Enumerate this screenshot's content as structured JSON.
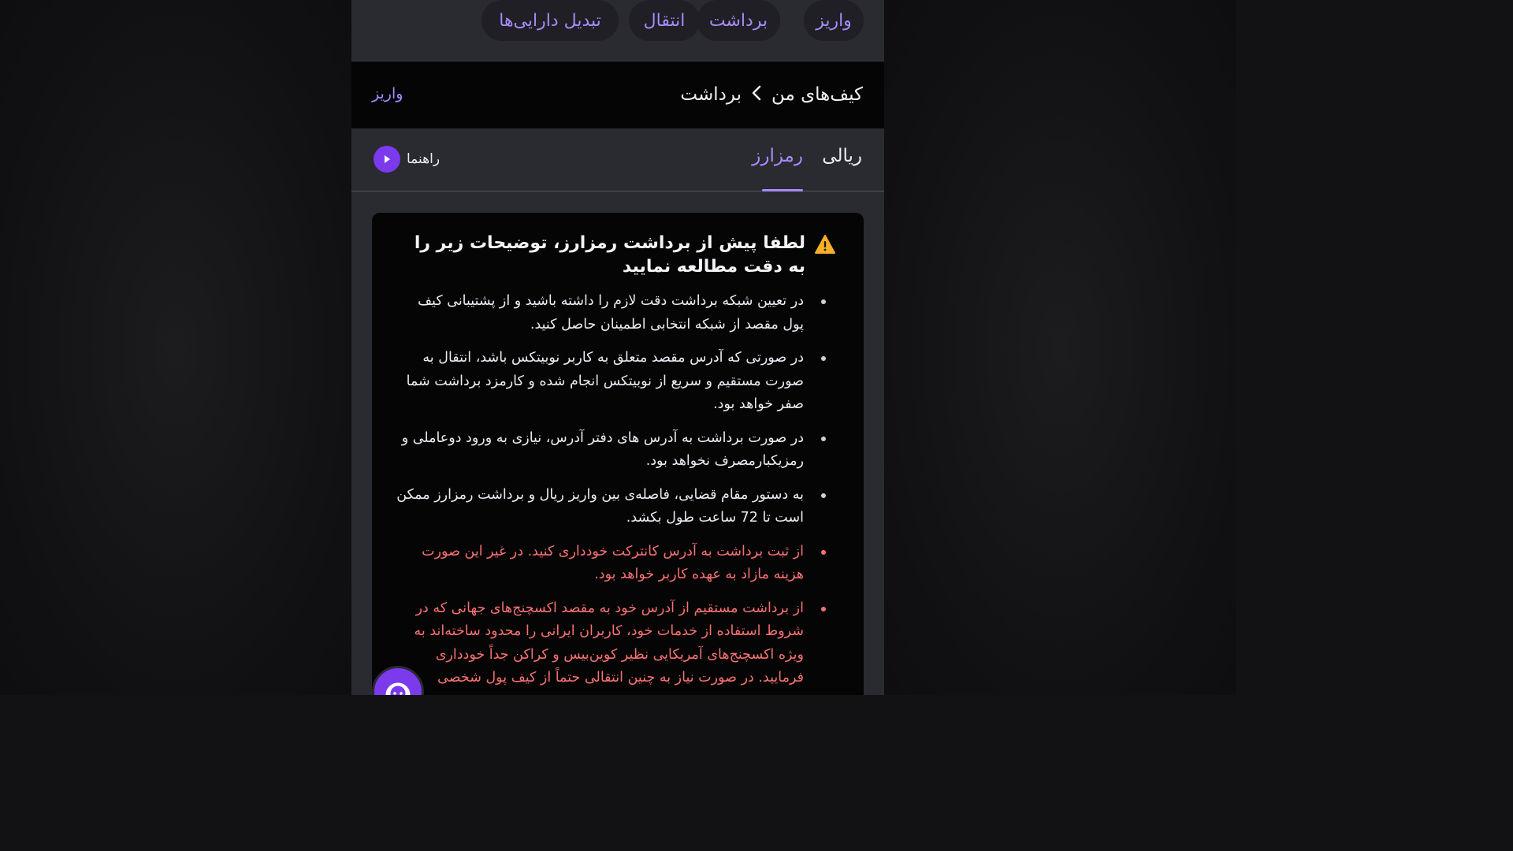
{
  "top_actions": [
    "واریز",
    "برداشت",
    "انتقال",
    "تبدیل دارایی‌ها"
  ],
  "header": {
    "breadcrumb_root": "کیف‌های من",
    "breadcrumb_current": "برداشت",
    "side_link": "واریز"
  },
  "tabs": [
    "ریالی",
    "رمزارز"
  ],
  "active_tab": "رمزارز",
  "guide_label": "راهنما",
  "notice": {
    "title": "لطفا پیش از برداشت رمزارز، توضیحات زیر را به دقت مطالعه نمایید",
    "items": [
      "در تعیین شبکه برداشت دقت لازم را داشته باشید و از پشتیبانی کیف پول مقصد از شبکه انتخابی اطمینان حاصل کنید.",
      "در صورتی که آدرس مقصد متعلق به کاربر نوبیتکس باشد، انتقال به صورت مستقیم و سریع از نوبیتکس انجام شده و کارمزد برداشت شما صفر خواهد بود.",
      "در صورت برداشت به آدرس های دفتر آدرس، نیازی به ورود دوعاملی و رمزیکبارمصرف نخواهد بود.",
      "به دستور مقام قضایی، فاصله‌ی بین واریز ریال و برداشت رمزارز ممکن است تا 72 ساعت طول بکشد.",
      "از ثبت برداشت به آدرس کانترکت خودداری کنید. در غیر این صورت هزینه مازاد به عهده کاربر خواهد بود.",
      "از برداشت مستقیم از آدرس خود به مقصد اکسچنج‌های جهانی که در شروط استفاده از خدمات خود، کاربران ایرانی را محدود ساخته‌اند به ویژه اکسچنج‌های آمریکایی نظیر کوین‌بیس و کراکن جداً خودداری فرمایید. در صورت نیاز به چنین انتقالی حتماً از کیف پول شخصی"
    ]
  },
  "colors": {
    "accent": "#a78bfa",
    "accent_strong": "#7c3aed",
    "warning_text": "#f87171",
    "panel": "#2a2a31",
    "card": "#050506"
  },
  "icons": {
    "breadcrumb_separator": "chevron-left-icon",
    "guide": "play-icon",
    "notice": "warning-icon",
    "support": "support-agent-icon"
  }
}
